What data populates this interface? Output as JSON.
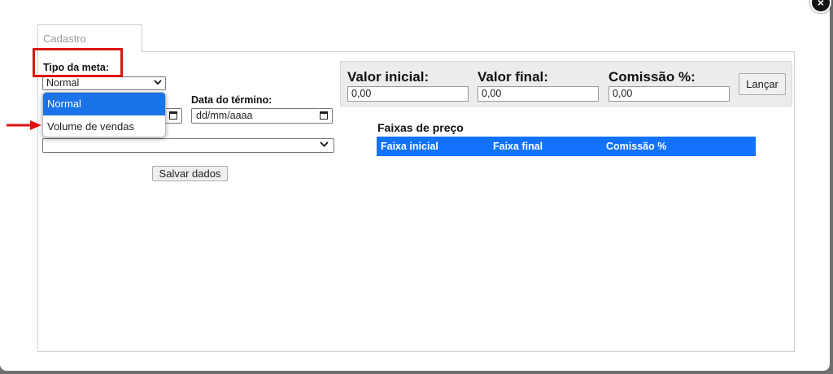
{
  "tab": {
    "label": "Cadastro"
  },
  "form": {
    "tipo_meta_label": "Tipo da meta:",
    "tipo_meta_value": "Normal",
    "tipo_meta_options": [
      "Normal",
      "Volume de vendas"
    ],
    "data_termino_label": "Data do término:",
    "data_termino_placeholder": "dd/mm/aaaa",
    "save_label": "Salvar dados"
  },
  "values": {
    "valor_inicial_label": "Valor inicial:",
    "valor_inicial_value": "0,00",
    "valor_final_label": "Valor final:",
    "valor_final_value": "0,00",
    "comissao_label": "Comissão %:",
    "comissao_value": "0,00",
    "lancar_label": "Lançar"
  },
  "faixas": {
    "title": "Faixas de preço",
    "columns": [
      "Faixa inicial",
      "Faixa final",
      "Comissão %"
    ]
  },
  "colors": {
    "accent_blue": "#1273ff",
    "dropdown_selected": "#1a73e8",
    "annotation_red": "#e01010"
  },
  "icons": {
    "close": "×",
    "chevron": "⌄"
  }
}
